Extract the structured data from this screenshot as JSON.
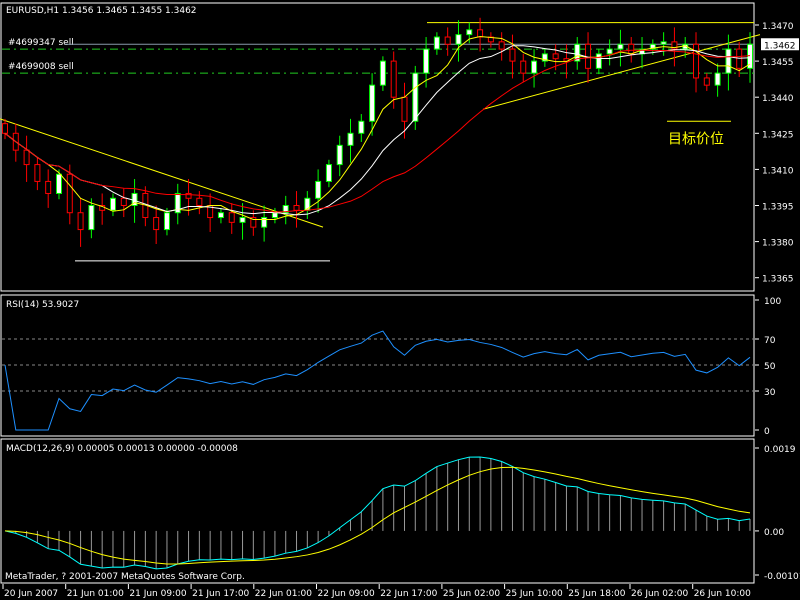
{
  "chart_data": {
    "type": "candlestick",
    "title": "EURUSD,H1  1.3456 1.3465 1.3455 1.3462",
    "symbol": "EURUSD",
    "timeframe": "H1",
    "bid": "1.3462",
    "price_ticks": [
      "1.3470",
      "1.3455",
      "1.3440",
      "1.3425",
      "1.3410",
      "1.3395",
      "1.3380",
      "1.3365"
    ],
    "ylim": [
      1.3359,
      1.3478
    ],
    "time_ticks": [
      "20 Jun 2007",
      "21 Jun 01:00",
      "21 Jun 09:00",
      "21 Jun 17:00",
      "22 Jun 01:00",
      "22 Jun 09:00",
      "22 Jun 17:00",
      "25 Jun 02:00",
      "25 Jun 10:00",
      "25 Jun 18:00",
      "26 Jun 02:00",
      "26 Jun 10:00"
    ],
    "closes": [
      1.3425,
      1.3418,
      1.3412,
      1.3405,
      1.34,
      1.3408,
      1.3392,
      1.3385,
      1.3395,
      1.3393,
      1.3398,
      1.3395,
      1.34,
      1.339,
      1.3385,
      1.3392,
      1.34,
      1.3398,
      1.3395,
      1.339,
      1.3392,
      1.3388,
      1.339,
      1.3386,
      1.339,
      1.3392,
      1.3395,
      1.3393,
      1.3398,
      1.3405,
      1.3412,
      1.342,
      1.3425,
      1.343,
      1.3445,
      1.3455,
      1.344,
      1.343,
      1.345,
      1.346,
      1.3465,
      1.3462,
      1.3466,
      1.3468,
      1.3465,
      1.3463,
      1.346,
      1.3455,
      1.345,
      1.3455,
      1.3458,
      1.3456,
      1.3455,
      1.3462,
      1.3452,
      1.3458,
      1.346,
      1.3462,
      1.3458,
      1.346,
      1.3462,
      1.3463,
      1.346,
      1.3462,
      1.3448,
      1.3445,
      1.345,
      1.346,
      1.3452,
      1.3462
    ],
    "moving_averages": [
      {
        "period": 5,
        "color": "#ffff00"
      },
      {
        "period": 10,
        "color": "#ffffff"
      },
      {
        "period": 20,
        "color": "#ff0000"
      }
    ],
    "orders": [
      {
        "label": "#4699347 sell",
        "price": 1.346
      },
      {
        "label": "#4699008 sell",
        "price": 1.345
      }
    ],
    "annotations": {
      "target_label": "目标价位",
      "target_price": 1.343,
      "support_price": 1.3372,
      "resistance_price": 1.3471
    },
    "rsi": {
      "label": "RSI(14) 53.9027",
      "period": 14,
      "ticks": [
        "100",
        "70",
        "50",
        "30",
        "0"
      ],
      "levels": [
        70,
        50,
        30
      ],
      "color": "#1e90ff"
    },
    "macd": {
      "label": "MACD(12,26,9) 0.00005 0.00013 0.00000 -0.00008",
      "ticks": [
        "0.0019",
        "0.00",
        "-0.00101"
      ],
      "ylim": [
        -0.00101,
        0.0019
      ],
      "main_color": "#00ffff",
      "signal_color": "#ffff00"
    },
    "copyright": "MetaTrader, ? 2001-2007 MetaQuotes Software Corp."
  }
}
